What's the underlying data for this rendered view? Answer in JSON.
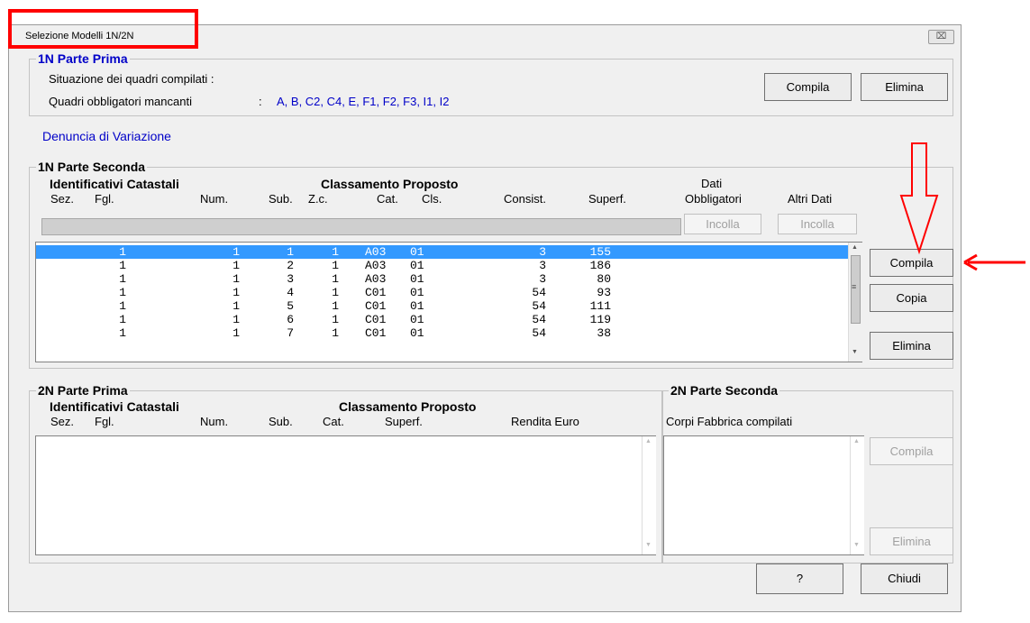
{
  "window": {
    "title": "Selezione Modelli 1N/2N",
    "close_glyph": "⌧"
  },
  "p1n_prima": {
    "legend": "1N Parte Prima",
    "situazione_label": "Situazione dei quadri compilati :",
    "mancanti_label": "Quadri obbligatori mancanti",
    "mancanti_sep": ":",
    "mancanti_value": "A, B, C2, C4, E, F1, F2, F3, I1, I2",
    "compila": "Compila",
    "elimina": "Elimina"
  },
  "denuncia": "Denuncia di Variazione",
  "p1n_seconda": {
    "legend": "1N Parte Seconda",
    "group_ident": "Identificativi Catastali",
    "group_class": "Classamento Proposto",
    "dati_line1": "Dati",
    "dati_line2": "Obbligatori",
    "altri_dati": "Altri Dati",
    "columns": [
      "Sez.",
      "Fgl.",
      "Num.",
      "Sub.",
      "Z.c.",
      "Cat.",
      "Cls.",
      "Consist.",
      "Superf."
    ],
    "incolla1": "Incolla",
    "incolla2": "Incolla",
    "rows": [
      [
        "1",
        "1",
        "1",
        "1",
        "A03",
        "01",
        "3",
        "155"
      ],
      [
        "1",
        "1",
        "2",
        "1",
        "A03",
        "01",
        "3",
        "186"
      ],
      [
        "1",
        "1",
        "3",
        "1",
        "A03",
        "01",
        "3",
        "80"
      ],
      [
        "1",
        "1",
        "4",
        "1",
        "C01",
        "01",
        "54",
        "93"
      ],
      [
        "1",
        "1",
        "5",
        "1",
        "C01",
        "01",
        "54",
        "111"
      ],
      [
        "1",
        "1",
        "6",
        "1",
        "C01",
        "01",
        "54",
        "119"
      ],
      [
        "1",
        "1",
        "7",
        "1",
        "C01",
        "01",
        "54",
        "38"
      ]
    ],
    "selected_row": 0,
    "compila": "Compila",
    "copia": "Copia",
    "elimina": "Elimina"
  },
  "p2n_prima": {
    "legend": "2N Parte Prima",
    "group_ident": "Identificativi Catastali",
    "group_class": "Classamento Proposto",
    "columns": [
      "Sez.",
      "Fgl.",
      "Num.",
      "Sub.",
      "Cat.",
      "Superf.",
      "Rendita Euro"
    ]
  },
  "p2n_seconda": {
    "legend": "2N Parte Seconda",
    "corpi_label": "Corpi Fabbrica compilati",
    "compila": "Compila",
    "elimina": "Elimina"
  },
  "footer": {
    "help": "?",
    "chiudi": "Chiudi"
  },
  "colors": {
    "annotation_red": "#ff0000",
    "selection": "#3399ff",
    "link_blue": "#0000c8"
  },
  "icons": {
    "scroll_up": "▲",
    "scroll_down": "▼",
    "grip": "≡"
  }
}
